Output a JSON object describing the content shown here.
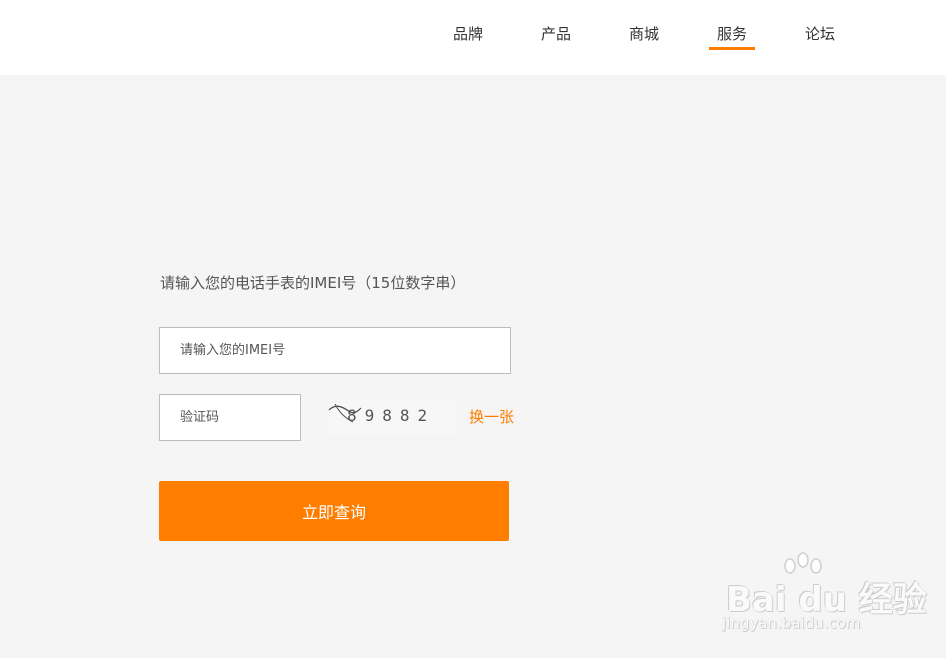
{
  "nav": {
    "items": [
      {
        "label": "品牌",
        "active": false
      },
      {
        "label": "产品",
        "active": false
      },
      {
        "label": "商城",
        "active": false
      },
      {
        "label": "服务",
        "active": true
      },
      {
        "label": "论坛",
        "active": false
      }
    ]
  },
  "form": {
    "prompt": "请输入您的电话手表的IMEI号（15位数字串）",
    "imei_placeholder": "请输入您的IMEI号",
    "imei_value": "",
    "captcha_placeholder": "验证码",
    "captcha_value": "",
    "captcha_text": "89882",
    "refresh_label": "换一张",
    "submit_label": "立即查询"
  },
  "watermark": {
    "logo": "Bai du 经验",
    "url": "jingyan.baidu.com"
  },
  "colors": {
    "accent": "#ff7e00",
    "background": "#f5f5f5",
    "header": "#ffffff"
  }
}
